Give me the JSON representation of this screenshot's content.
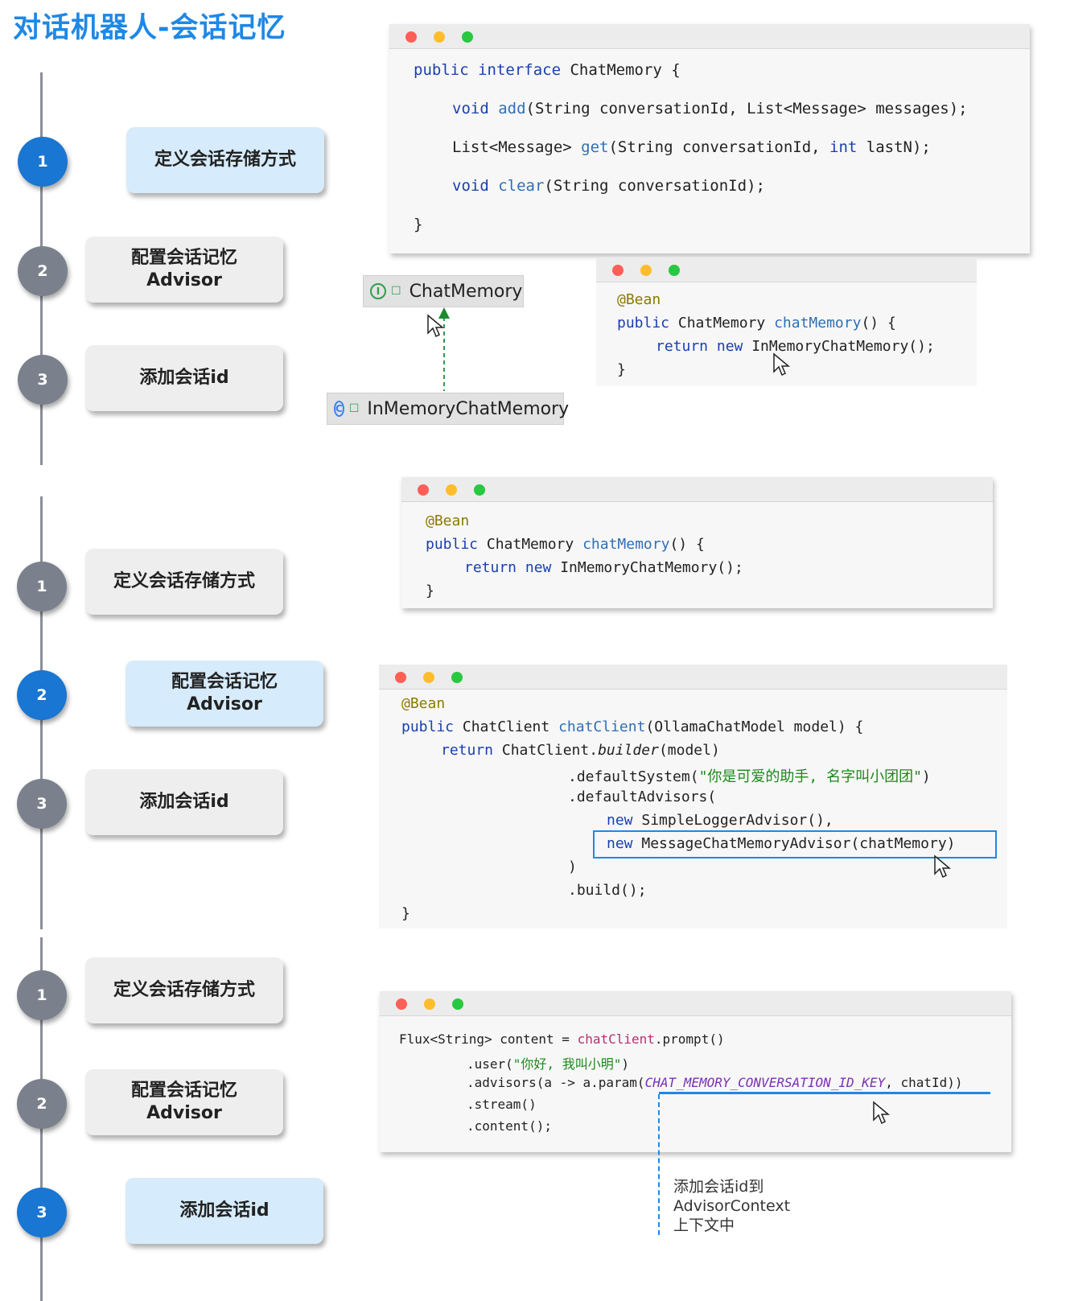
{
  "title": "对话机器人-会话记忆",
  "sections": [
    {
      "steps": [
        {
          "num": "1",
          "label": "定义会话存储方式",
          "label2": "",
          "active": true
        },
        {
          "num": "2",
          "label": "配置会话记忆",
          "label2": "Advisor",
          "active": false
        },
        {
          "num": "3",
          "label": "添加会话id",
          "label2": "",
          "active": false
        }
      ]
    },
    {
      "steps": [
        {
          "num": "1",
          "label": "定义会话存储方式",
          "label2": "",
          "active": false
        },
        {
          "num": "2",
          "label": "配置会话记忆",
          "label2": "Advisor",
          "active": true
        },
        {
          "num": "3",
          "label": "添加会话id",
          "label2": "",
          "active": false
        }
      ]
    },
    {
      "steps": [
        {
          "num": "1",
          "label": "定义会话存储方式",
          "label2": "",
          "active": false
        },
        {
          "num": "2",
          "label": "配置会话记忆",
          "label2": "Advisor",
          "active": false
        },
        {
          "num": "3",
          "label": "添加会话id",
          "label2": "",
          "active": true
        }
      ]
    }
  ],
  "uml": {
    "interface_name": "ChatMemory",
    "interface_icon": "I",
    "class_name": "InMemoryChatMemory",
    "class_icon": "C"
  },
  "code": {
    "interface": {
      "l1_kw": "public interface ",
      "l1_rest": "ChatMemory {",
      "l2_kw": "void ",
      "l2_fn": "add",
      "l2_rest": "(String conversationId, List<Message> messages);",
      "l3_a": "List<Message> ",
      "l3_fn": "get",
      "l3_b": "(String conversationId, ",
      "l3_kw": "int",
      "l3_c": " lastN);",
      "l4_kw": "void ",
      "l4_fn": "clear",
      "l4_rest": "(String conversationId);",
      "l5": "}"
    },
    "bean": {
      "ann": "@Bean",
      "l2_kw": "public ",
      "l2_type": "ChatMemory ",
      "l2_fn": "chatMemory",
      "l2_rest": "() {",
      "l3_kw": "return new ",
      "l3_rest": "InMemoryChatMemory();",
      "l4": "}"
    },
    "client": {
      "ann": "@Bean",
      "l2_kw": "public ",
      "l2_type": "ChatClient ",
      "l2_fn": "chatClient",
      "l2_rest": "(OllamaChatModel model) {",
      "l3_kw": "return ",
      "l3_a": "ChatClient.",
      "l3_it": "builder",
      "l3_b": "(model)",
      "l4_a": ".defaultSystem(",
      "l4_str": "\"你是可爱的助手, 名字叫小团团\"",
      "l4_b": ")",
      "l5": ".defaultAdvisors(",
      "l6_kw": "new ",
      "l6_rest": "SimpleLoggerAdvisor(),",
      "l7_kw": "new ",
      "l7_rest": "MessageChatMemoryAdvisor(chatMemory)",
      "l8": ")",
      "l9": ".build();",
      "l10": "}"
    },
    "prompt": {
      "l1_a": "Flux<String> content = ",
      "l1_mag": "chatClient",
      "l1_b": ".prompt()",
      "l2_a": ".user(",
      "l2_str": "\"你好, 我叫小明\"",
      "l2_b": ")",
      "l3_a": ".advisors(a -> a.param(",
      "l3_const": "CHAT_MEMORY_CONVERSATION_ID_KEY",
      "l3_b": ", chatId))",
      "l4": ".stream()",
      "l5": ".content();"
    }
  },
  "note": {
    "line1": "添加会话id到",
    "line2": "AdvisorContext",
    "line3": "上下文中"
  },
  "colors": {
    "active_circle": "#1976d2",
    "inactive_circle": "#7b818c",
    "active_box": "#d6ebfb",
    "inactive_box": "#eeeeee",
    "highlight": "#1e88e5"
  }
}
